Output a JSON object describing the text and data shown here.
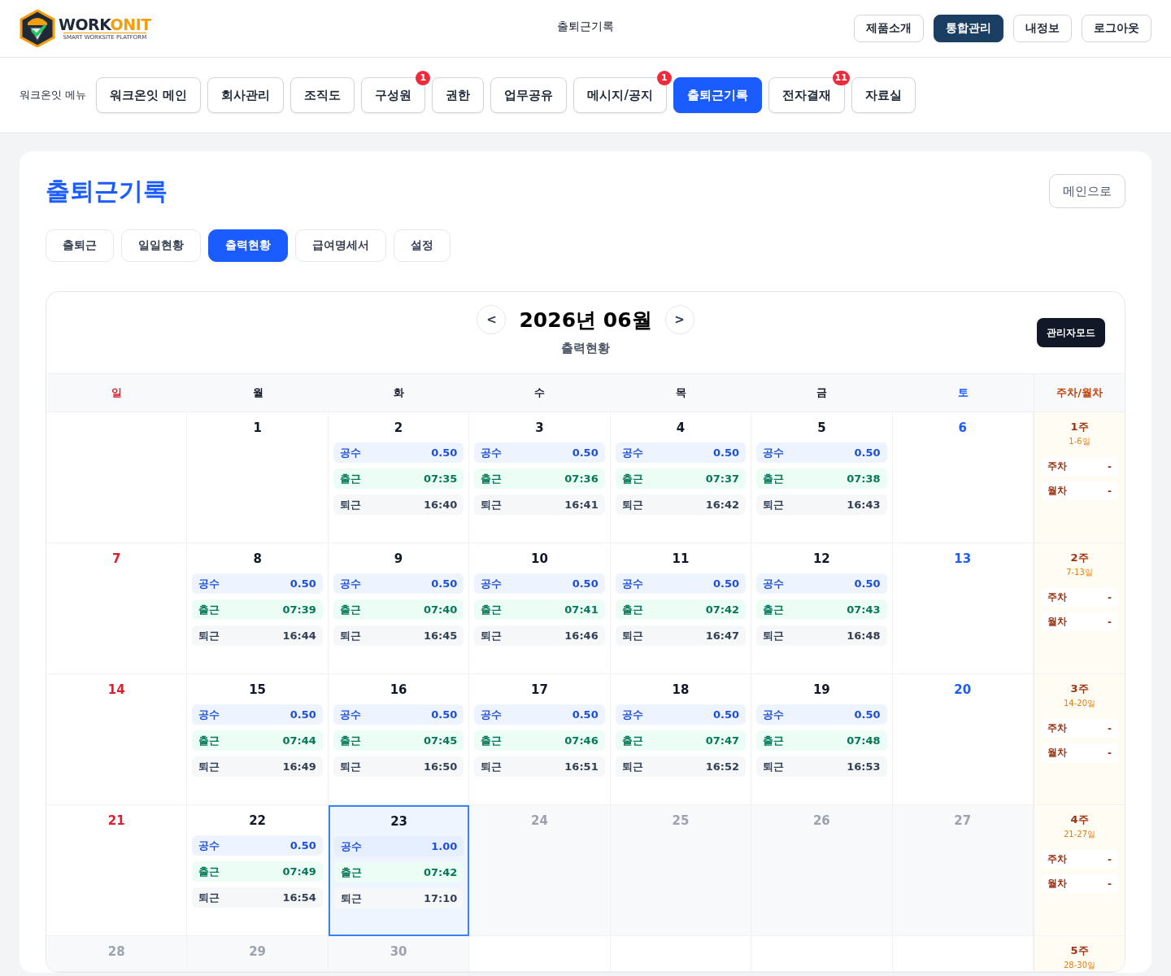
{
  "header": {
    "logo": {
      "brand_primary": "WORK",
      "brand_accent": "ONIT",
      "tagline": "SMART WORKSITE PLATFORM"
    },
    "page_title": "출퇴근기록",
    "buttons": [
      {
        "label": "제품소개",
        "selected": false
      },
      {
        "label": "통합관리",
        "selected": true
      },
      {
        "label": "내정보",
        "selected": false
      },
      {
        "label": "로그아웃",
        "selected": false
      }
    ]
  },
  "menu": {
    "label": "워크온잇 메뉴",
    "items": [
      {
        "label": "워크온잇 메인",
        "selected": false
      },
      {
        "label": "회사관리",
        "selected": false
      },
      {
        "label": "조직도",
        "selected": false
      },
      {
        "label": "구성원",
        "selected": false,
        "badge": "1"
      },
      {
        "label": "권한",
        "selected": false
      },
      {
        "label": "업무공유",
        "selected": false
      },
      {
        "label": "메시지/공지",
        "selected": false,
        "badge": "1"
      },
      {
        "label": "출퇴근기록",
        "selected": true
      },
      {
        "label": "전자결재",
        "selected": false,
        "badge": "11"
      },
      {
        "label": "자료실",
        "selected": false
      }
    ]
  },
  "content": {
    "title": "출퇴근기록",
    "back_button": "메인으로",
    "tabs": [
      {
        "label": "출퇴근",
        "selected": false
      },
      {
        "label": "일일현황",
        "selected": false
      },
      {
        "label": "출력현황",
        "selected": true
      },
      {
        "label": "급여명세서",
        "selected": false
      },
      {
        "label": "설정",
        "selected": false
      }
    ],
    "calendar": {
      "prev": "<",
      "month": "2026년 06월",
      "next": ">",
      "subtitle": "출력현황",
      "admin_button": "관리자모드",
      "weekdays": [
        {
          "label": "일",
          "kind": "sun"
        },
        {
          "label": "월",
          "kind": "weekday"
        },
        {
          "label": "화",
          "kind": "weekday"
        },
        {
          "label": "수",
          "kind": "weekday"
        },
        {
          "label": "목",
          "kind": "weekday"
        },
        {
          "label": "금",
          "kind": "weekday"
        },
        {
          "label": "토",
          "kind": "sat"
        }
      ],
      "summary_heading": "주차/월차",
      "weeks": [
        {
          "days": [
            {
              "kind": "empty",
              "selected": false
            },
            {
              "kind": "weekday",
              "day": "1",
              "selected": false
            },
            {
              "kind": "weekday",
              "day": "2",
              "selected": false,
              "records": [
                {
                  "kind": "gongsu",
                  "label": "공수",
                  "value": "0.50"
                },
                {
                  "kind": "in",
                  "label": "출근",
                  "value": "07:35"
                },
                {
                  "kind": "out",
                  "label": "퇴근",
                  "value": "16:40"
                }
              ]
            },
            {
              "kind": "weekday",
              "day": "3",
              "selected": false,
              "records": [
                {
                  "kind": "gongsu",
                  "label": "공수",
                  "value": "0.50"
                },
                {
                  "kind": "in",
                  "label": "출근",
                  "value": "07:36"
                },
                {
                  "kind": "out",
                  "label": "퇴근",
                  "value": "16:41"
                }
              ]
            },
            {
              "kind": "weekday",
              "day": "4",
              "selected": false,
              "records": [
                {
                  "kind": "gongsu",
                  "label": "공수",
                  "value": "0.50"
                },
                {
                  "kind": "in",
                  "label": "출근",
                  "value": "07:37"
                },
                {
                  "kind": "out",
                  "label": "퇴근",
                  "value": "16:42"
                }
              ]
            },
            {
              "kind": "weekday",
              "day": "5",
              "selected": false,
              "records": [
                {
                  "kind": "gongsu",
                  "label": "공수",
                  "value": "0.50"
                },
                {
                  "kind": "in",
                  "label": "출근",
                  "value": "07:38"
                },
                {
                  "kind": "out",
                  "label": "퇴근",
                  "value": "16:43"
                }
              ]
            },
            {
              "kind": "sat",
              "day": "6",
              "selected": false
            }
          ],
          "summary": {
            "title": "1주",
            "range": "1-6일",
            "rows": [
              {
                "label": "주차",
                "value": "-"
              },
              {
                "label": "월차",
                "value": "-"
              }
            ]
          }
        },
        {
          "days": [
            {
              "kind": "sun",
              "day": "7",
              "selected": false
            },
            {
              "kind": "weekday",
              "day": "8",
              "selected": false,
              "records": [
                {
                  "kind": "gongsu",
                  "label": "공수",
                  "value": "0.50"
                },
                {
                  "kind": "in",
                  "label": "출근",
                  "value": "07:39"
                },
                {
                  "kind": "out",
                  "label": "퇴근",
                  "value": "16:44"
                }
              ]
            },
            {
              "kind": "weekday",
              "day": "9",
              "selected": false,
              "records": [
                {
                  "kind": "gongsu",
                  "label": "공수",
                  "value": "0.50"
                },
                {
                  "kind": "in",
                  "label": "출근",
                  "value": "07:40"
                },
                {
                  "kind": "out",
                  "label": "퇴근",
                  "value": "16:45"
                }
              ]
            },
            {
              "kind": "weekday",
              "day": "10",
              "selected": false,
              "records": [
                {
                  "kind": "gongsu",
                  "label": "공수",
                  "value": "0.50"
                },
                {
                  "kind": "in",
                  "label": "출근",
                  "value": "07:41"
                },
                {
                  "kind": "out",
                  "label": "퇴근",
                  "value": "16:46"
                }
              ]
            },
            {
              "kind": "weekday",
              "day": "11",
              "selected": false,
              "records": [
                {
                  "kind": "gongsu",
                  "label": "공수",
                  "value": "0.50"
                },
                {
                  "kind": "in",
                  "label": "출근",
                  "value": "07:42"
                },
                {
                  "kind": "out",
                  "label": "퇴근",
                  "value": "16:47"
                }
              ]
            },
            {
              "kind": "weekday",
              "day": "12",
              "selected": false,
              "records": [
                {
                  "kind": "gongsu",
                  "label": "공수",
                  "value": "0.50"
                },
                {
                  "kind": "in",
                  "label": "출근",
                  "value": "07:43"
                },
                {
                  "kind": "out",
                  "label": "퇴근",
                  "value": "16:48"
                }
              ]
            },
            {
              "kind": "sat",
              "day": "13",
              "selected": false
            }
          ],
          "summary": {
            "title": "2주",
            "range": "7-13일",
            "rows": [
              {
                "label": "주차",
                "value": "-"
              },
              {
                "label": "월차",
                "value": "-"
              }
            ]
          }
        },
        {
          "days": [
            {
              "kind": "sun",
              "day": "14",
              "selected": false
            },
            {
              "kind": "weekday",
              "day": "15",
              "selected": false,
              "records": [
                {
                  "kind": "gongsu",
                  "label": "공수",
                  "value": "0.50"
                },
                {
                  "kind": "in",
                  "label": "출근",
                  "value": "07:44"
                },
                {
                  "kind": "out",
                  "label": "퇴근",
                  "value": "16:49"
                }
              ]
            },
            {
              "kind": "weekday",
              "day": "16",
              "selected": false,
              "records": [
                {
                  "kind": "gongsu",
                  "label": "공수",
                  "value": "0.50"
                },
                {
                  "kind": "in",
                  "label": "출근",
                  "value": "07:45"
                },
                {
                  "kind": "out",
                  "label": "퇴근",
                  "value": "16:50"
                }
              ]
            },
            {
              "kind": "weekday",
              "day": "17",
              "selected": false,
              "records": [
                {
                  "kind": "gongsu",
                  "label": "공수",
                  "value": "0.50"
                },
                {
                  "kind": "in",
                  "label": "출근",
                  "value": "07:46"
                },
                {
                  "kind": "out",
                  "label": "퇴근",
                  "value": "16:51"
                }
              ]
            },
            {
              "kind": "weekday",
              "day": "18",
              "selected": false,
              "records": [
                {
                  "kind": "gongsu",
                  "label": "공수",
                  "value": "0.50"
                },
                {
                  "kind": "in",
                  "label": "출근",
                  "value": "07:47"
                },
                {
                  "kind": "out",
                  "label": "퇴근",
                  "value": "16:52"
                }
              ]
            },
            {
              "kind": "weekday",
              "day": "19",
              "selected": false,
              "records": [
                {
                  "kind": "gongsu",
                  "label": "공수",
                  "value": "0.50"
                },
                {
                  "kind": "in",
                  "label": "출근",
                  "value": "07:48"
                },
                {
                  "kind": "out",
                  "label": "퇴근",
                  "value": "16:53"
                }
              ]
            },
            {
              "kind": "sat",
              "day": "20",
              "selected": false
            }
          ],
          "summary": {
            "title": "3주",
            "range": "14-20일",
            "rows": [
              {
                "label": "주차",
                "value": "-"
              },
              {
                "label": "월차",
                "value": "-"
              }
            ]
          }
        },
        {
          "days": [
            {
              "kind": "sun",
              "day": "21",
              "selected": false
            },
            {
              "kind": "weekday",
              "day": "22",
              "selected": false,
              "records": [
                {
                  "kind": "gongsu",
                  "label": "공수",
                  "value": "0.50"
                },
                {
                  "kind": "in",
                  "label": "출근",
                  "value": "07:49"
                },
                {
                  "kind": "out",
                  "label": "퇴근",
                  "value": "16:54"
                }
              ]
            },
            {
              "kind": "weekday",
              "day": "23",
              "selected": true,
              "records": [
                {
                  "kind": "gongsu",
                  "label": "공수",
                  "value": "1.00"
                },
                {
                  "kind": "in",
                  "label": "출근",
                  "value": "07:42"
                },
                {
                  "kind": "out",
                  "label": "퇴근",
                  "value": "17:10"
                }
              ]
            },
            {
              "kind": "future",
              "day": "24",
              "selected": false
            },
            {
              "kind": "future",
              "day": "25",
              "selected": false
            },
            {
              "kind": "future",
              "day": "26",
              "selected": false
            },
            {
              "kind": "future",
              "day": "27",
              "selected": false
            }
          ],
          "summary": {
            "title": "4주",
            "range": "21-27일",
            "rows": [
              {
                "label": "주차",
                "value": "-"
              },
              {
                "label": "월차",
                "value": "-"
              }
            ]
          }
        },
        {
          "days": [
            {
              "kind": "future",
              "day": "28",
              "selected": false
            },
            {
              "kind": "future",
              "day": "29",
              "selected": false
            },
            {
              "kind": "future",
              "day": "30",
              "selected": false
            },
            {
              "kind": "empty",
              "selected": false
            },
            {
              "kind": "empty",
              "selected": false
            },
            {
              "kind": "empty",
              "selected": false
            },
            {
              "kind": "empty",
              "selected": false
            }
          ],
          "summary": {
            "title": "5주",
            "range": "28-30일"
          }
        }
      ]
    }
  }
}
